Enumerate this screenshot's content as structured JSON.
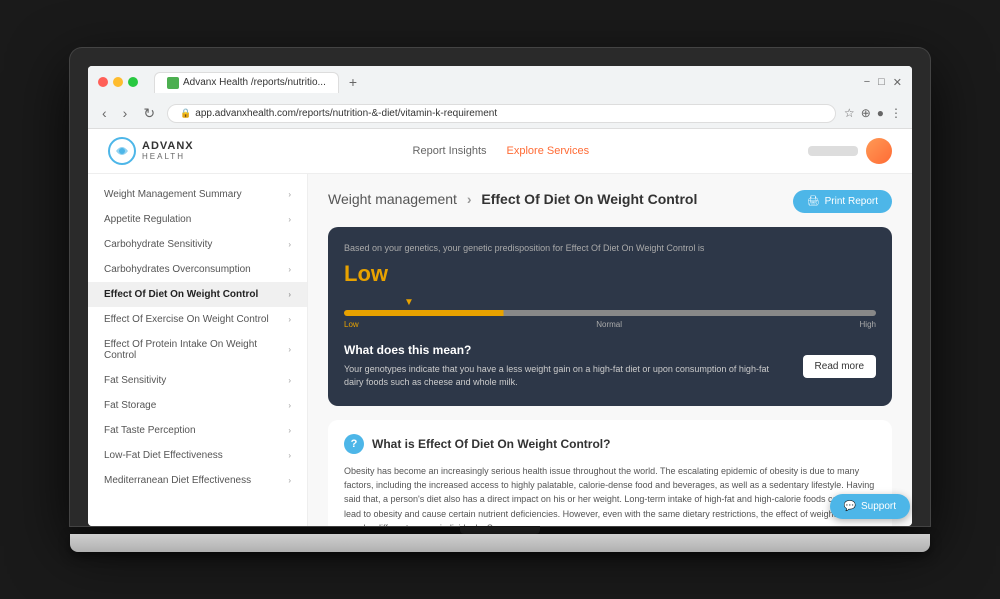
{
  "browser": {
    "tab_title": "Advanx Health /reports/nutritio...",
    "url": "app.advanxhealth.com/reports/nutrition-&-diet/vitamin-k-requirement",
    "plus_label": "+"
  },
  "header": {
    "logo_text": "ADVANX",
    "logo_sub": "HEALTH",
    "nav_items": [
      {
        "label": "Report Insights",
        "active": false
      },
      {
        "label": "Explore Services",
        "active": true
      }
    ]
  },
  "sidebar": {
    "items": [
      {
        "label": "Weight Management Summary",
        "active": false
      },
      {
        "label": "Appetite Regulation",
        "active": false
      },
      {
        "label": "Carbohydrate Sensitivity",
        "active": false
      },
      {
        "label": "Carbohydrates Overconsumption",
        "active": false
      },
      {
        "label": "Effect Of Diet On Weight Control",
        "active": true
      },
      {
        "label": "Effect Of Exercise On Weight Control",
        "active": false
      },
      {
        "label": "Effect Of Protein Intake On Weight Control",
        "active": false
      },
      {
        "label": "Fat Sensitivity",
        "active": false
      },
      {
        "label": "Fat Storage",
        "active": false
      },
      {
        "label": "Fat Taste Perception",
        "active": false
      },
      {
        "label": "Low-Fat Diet Effectiveness",
        "active": false
      },
      {
        "label": "Mediterranean Diet Effectiveness",
        "active": false
      }
    ]
  },
  "page": {
    "breadcrumb_parent": "Weight management",
    "breadcrumb_current": "Effect Of Diet On Weight Control",
    "print_button": "Print Report"
  },
  "dark_card": {
    "subtitle": "Based on your genetics, your genetic predisposition for Effect Of Diet On Weight Control is",
    "predisposition": "Low",
    "scale_labels": {
      "low": "Low",
      "normal": "Normal",
      "high": "High"
    },
    "meaning_title": "What does this mean?",
    "meaning_body": "Your genotypes indicate that you have a less weight gain on a high-fat diet or upon consumption of high-fat dairy foods such as cheese and whole milk.",
    "read_more": "Read more"
  },
  "info_section": {
    "icon": "?",
    "title": "What is Effect Of Diet On Weight Control?",
    "body": "Obesity has become an increasingly serious health issue throughout the world. The escalating epidemic of obesity is due to many factors, including the increased access to highly palatable, calorie-dense food and beverages, as well as a sedentary lifestyle. Having said that, a person's diet also has a direct impact on his or her weight. Long-term intake of high-fat and high-calorie foods can easily lead to obesity and cause certain nutrient deficiencies. However, even with the same dietary restrictions, the effect of weight control may be different across individuals. Some"
  },
  "support": {
    "label": "Support"
  }
}
